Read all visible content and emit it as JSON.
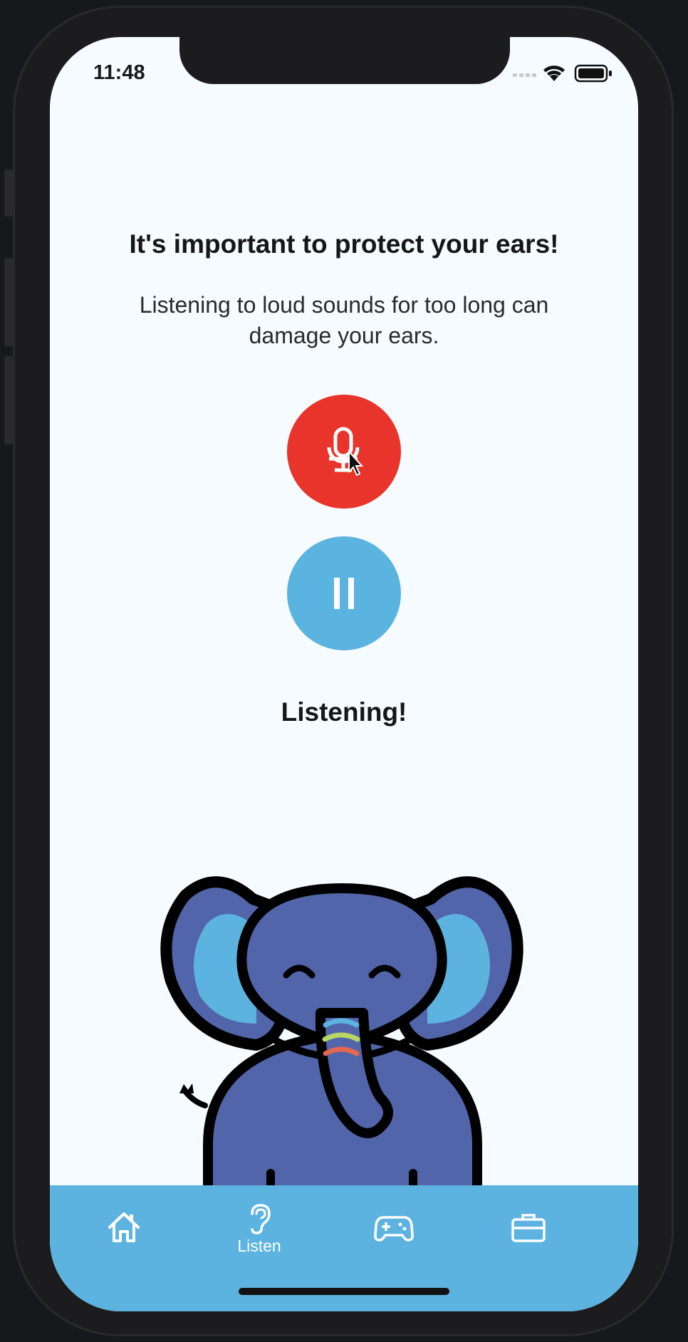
{
  "status_bar": {
    "time": "11:48"
  },
  "content": {
    "title": "It's important to protect your ears!",
    "subtitle": "Listening to loud sounds for too long can damage your ears.",
    "status": "Listening!"
  },
  "tabs": [
    {
      "label": "",
      "icon": "home-icon",
      "active": false
    },
    {
      "label": "Listen",
      "icon": "ear-icon",
      "active": true
    },
    {
      "label": "",
      "icon": "gamepad-icon",
      "active": false
    },
    {
      "label": "",
      "icon": "briefcase-icon",
      "active": false
    }
  ],
  "colors": {
    "mic_button": "#e8342a",
    "pause_button": "#5bb3df",
    "tab_bar": "#5cb3df",
    "background": "#f6fbff",
    "elephant_body": "#5265aa",
    "elephant_ear_inner": "#5db3e0"
  }
}
